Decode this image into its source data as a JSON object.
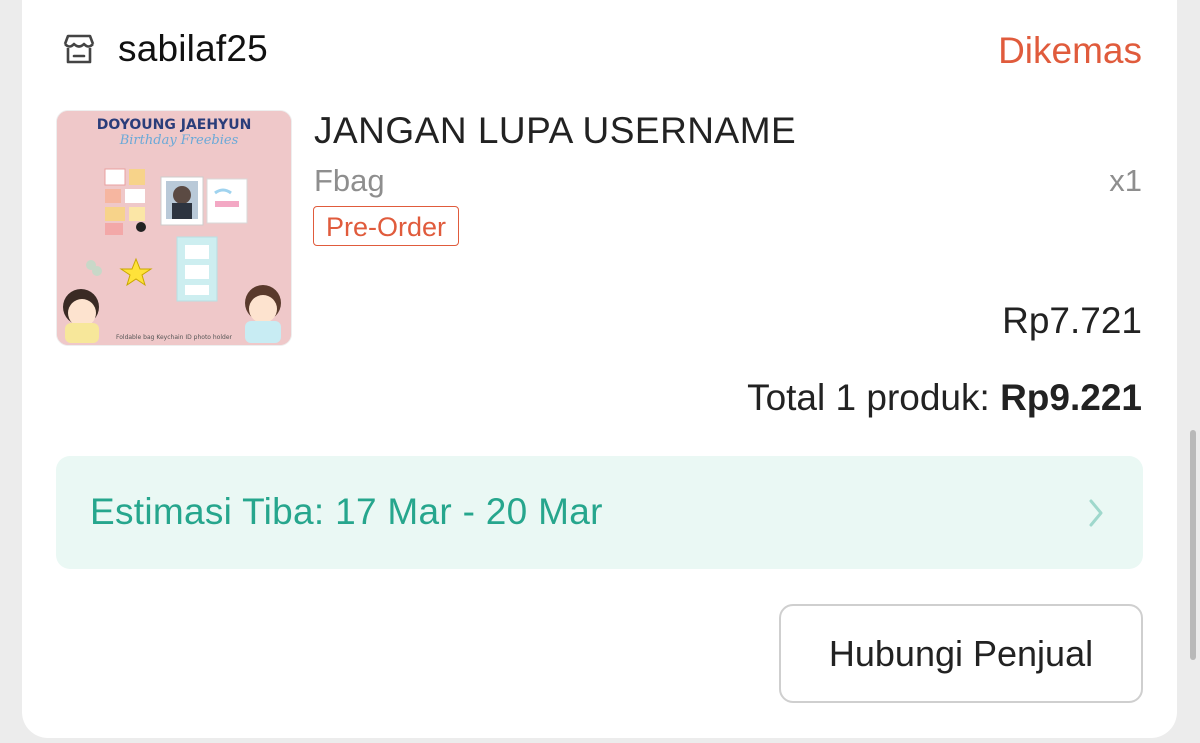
{
  "shop": {
    "icon": "store-icon",
    "name": "sabilaf25"
  },
  "order": {
    "status": "Dikemas"
  },
  "product": {
    "thumbnail": {
      "icon": "product-thumbnail",
      "title_line1": "DOYOUNG JAEHYUN",
      "title_line2": "Birthday Freebies",
      "caption": "Foldable bag  Keychain  ID photo holder"
    },
    "name": "JANGAN LUPA USERNAME",
    "variant": "Fbag",
    "quantity": "x1",
    "badge": "Pre-Order",
    "price": "Rp7.721"
  },
  "total": {
    "label": "Total 1 produk:",
    "amount": "Rp9.221"
  },
  "delivery": {
    "eta_text": "Estimasi Tiba: 17 Mar - 20 Mar",
    "icon": "chevron-right-icon"
  },
  "actions": {
    "contact_seller": "Hubungi Penjual"
  },
  "colors": {
    "accent": "#e05b3c",
    "eta_text": "#26a68d",
    "eta_background": "#eaf8f4"
  }
}
